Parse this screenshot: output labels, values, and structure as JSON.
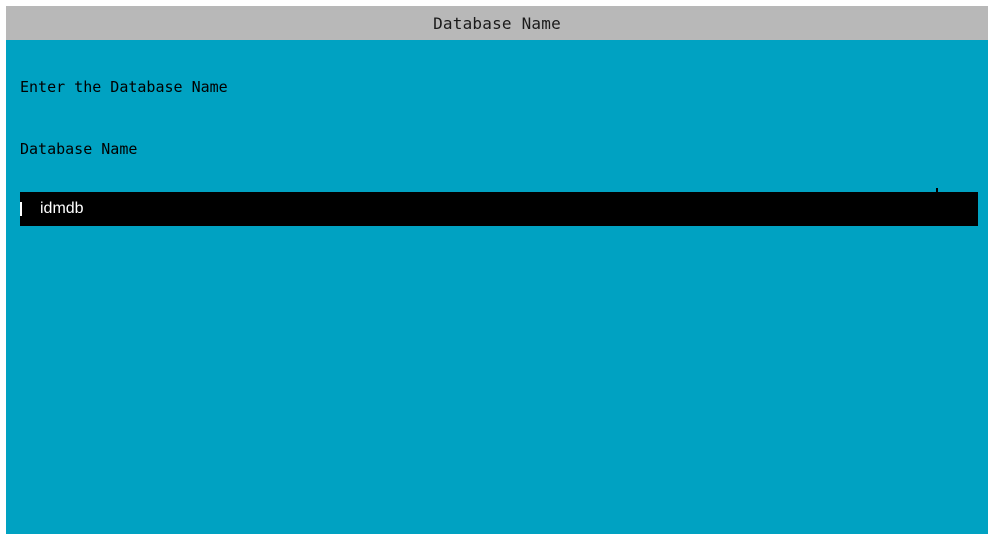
{
  "window": {
    "title": "Database Name"
  },
  "form": {
    "prompt": "Enter the Database Name",
    "field_label": "Database Name",
    "field_value": "idmdb"
  },
  "colors": {
    "background": "#00A2C2",
    "titlebar": "#B8B8B8",
    "input_background": "#000000",
    "input_text": "#FFFFFF"
  }
}
